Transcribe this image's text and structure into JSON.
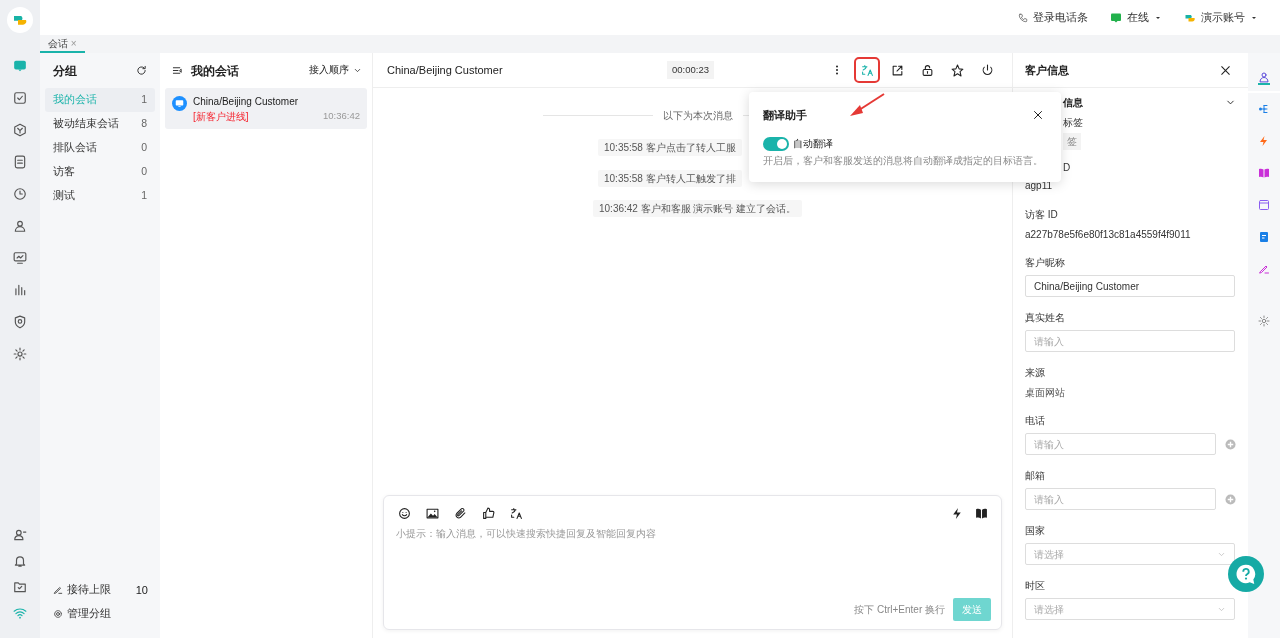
{
  "topbar": {
    "items": [
      {
        "kind": "phone",
        "label": "登录电话条"
      },
      {
        "kind": "status",
        "label": "在线"
      },
      {
        "kind": "account",
        "label": "演示账号"
      }
    ]
  },
  "rail": {
    "items": [
      {
        "kind": "chat",
        "selected": true
      },
      {
        "kind": "task",
        "selected": false
      },
      {
        "kind": "cube",
        "selected": false
      },
      {
        "kind": "doc",
        "selected": false
      },
      {
        "kind": "clock",
        "selected": false
      },
      {
        "kind": "person",
        "selected": false
      },
      {
        "kind": "monitor",
        "selected": false
      },
      {
        "kind": "chart",
        "selected": false
      },
      {
        "kind": "shield",
        "selected": false
      },
      {
        "kind": "gear",
        "selected": false
      }
    ],
    "bottom": [
      {
        "kind": "user"
      },
      {
        "kind": "bell"
      },
      {
        "kind": "folder"
      },
      {
        "kind": "wifi"
      }
    ]
  },
  "tabs": [
    {
      "label": "会话",
      "selected": true,
      "close": "×"
    }
  ],
  "groups": {
    "title": "分组",
    "items": [
      {
        "label": "我的会话",
        "count": "1",
        "selected": true
      },
      {
        "label": "被动结束会话",
        "count": "8",
        "selected": false
      },
      {
        "label": "排队会话",
        "count": "0",
        "selected": false
      },
      {
        "label": "访客",
        "count": "0",
        "selected": false
      },
      {
        "label": "测试",
        "count": "1",
        "selected": false
      }
    ],
    "footer": [
      {
        "kind": "limit",
        "label": "接待上限",
        "value": "10"
      },
      {
        "kind": "manage",
        "label": "管理分组"
      }
    ]
  },
  "conversations": {
    "title": "我的会话",
    "sort": "接入顺序",
    "items": [
      {
        "name": "China/Beijing Customer",
        "tag": "[新客户进线]",
        "time": "10:36:42",
        "selected": true
      }
    ]
  },
  "chat": {
    "title": "China/Beijing Customer",
    "timer": "00:00:23",
    "tools": [
      {
        "kind": "more",
        "selected": false
      },
      {
        "kind": "translate",
        "selected": true
      },
      {
        "kind": "share",
        "selected": false
      },
      {
        "kind": "lock",
        "selected": false
      },
      {
        "kind": "star",
        "selected": false
      },
      {
        "kind": "power",
        "selected": false
      }
    ],
    "divider": "以下为本次消息",
    "events": [
      "10:35:58 客户点击了转人工服",
      "10:35:58 客户转人工触发了排",
      "10:36:42 客户和客服 演示账号 建立了会话。"
    ],
    "composer": {
      "tools": [
        {
          "kind": "emoji"
        },
        {
          "kind": "image"
        },
        {
          "kind": "clip"
        },
        {
          "kind": "like"
        },
        {
          "kind": "translate"
        }
      ],
      "right_tools": [
        {
          "kind": "bolt"
        },
        {
          "kind": "book"
        }
      ],
      "placeholder": "小提示：输入消息，可以快速搜索快捷回复及智能回复内容",
      "hint": "按下 Ctrl+Enter 换行",
      "send": "发送",
      "send_disabled": true
    }
  },
  "popover": {
    "title": "翻译助手",
    "toggle": {
      "label": "自动翻译",
      "on": true
    },
    "description": "开启后，客户和客服发送的消息将自动翻译成指定的目标语言。"
  },
  "customer": {
    "title": "客户信息",
    "section": "信息",
    "tag_label": "标签",
    "tag": "签",
    "id_label": "D",
    "id_value": "agp11",
    "fields": [
      {
        "kind": "text",
        "label": "访客 ID",
        "value": "a227b78e5f6e80f13c81a4559f4f9011"
      },
      {
        "kind": "input",
        "label": "客户昵称",
        "value": "China/Beijing Customer"
      },
      {
        "kind": "input",
        "label": "真实姓名",
        "placeholder": "请输入"
      },
      {
        "kind": "muted",
        "label": "来源",
        "value": "桌面网站"
      },
      {
        "kind": "input_add",
        "label": "电话",
        "placeholder": "请输入"
      },
      {
        "kind": "input_add",
        "label": "邮箱",
        "placeholder": "请输入"
      },
      {
        "kind": "select",
        "label": "国家",
        "placeholder": "请选择"
      },
      {
        "kind": "select",
        "label": "时区",
        "placeholder": "请选择"
      }
    ]
  },
  "side_tools": [
    {
      "kind": "person",
      "selected": true
    },
    {
      "kind": "tree",
      "selected": false
    },
    {
      "kind": "bolt",
      "selected": false
    },
    {
      "kind": "book",
      "selected": false
    },
    {
      "kind": "window",
      "selected": false
    },
    {
      "kind": "note",
      "selected": false
    },
    {
      "kind": "pen",
      "selected": false
    },
    {
      "kind": "gear",
      "selected": false
    }
  ]
}
